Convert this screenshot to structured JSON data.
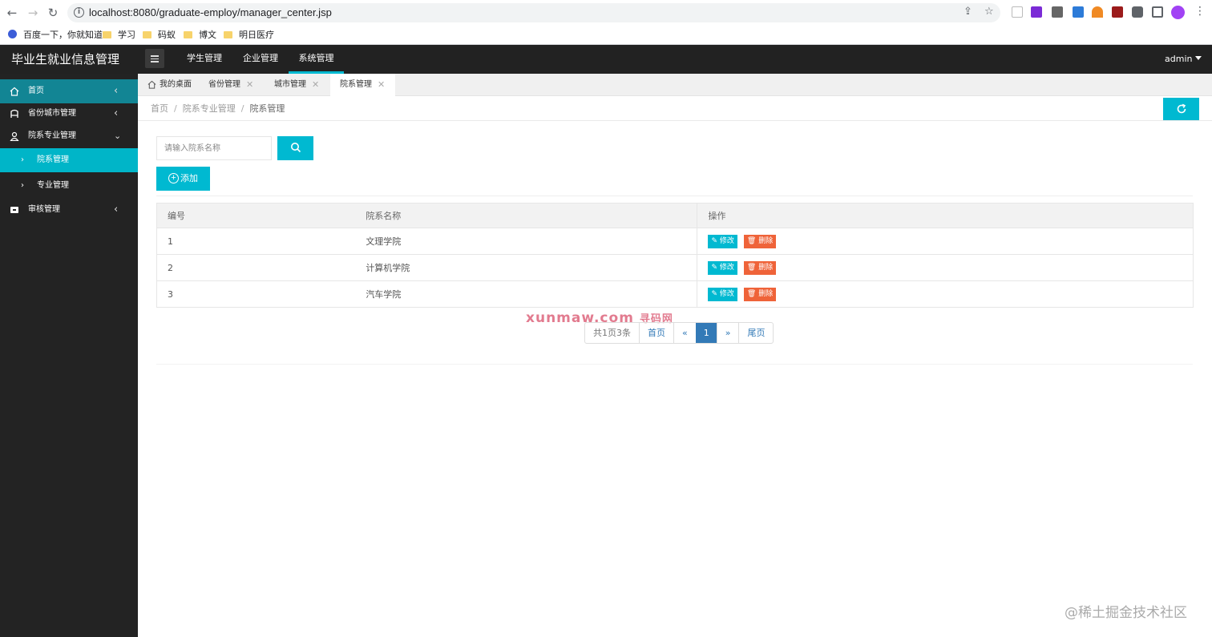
{
  "browser": {
    "url": "localhost:8080/graduate-employ/manager_center.jsp",
    "bookmarks": [
      "百度一下，你就知道",
      "学习",
      "码蚁",
      "博文",
      "明日医疗"
    ]
  },
  "app": {
    "title": "毕业生就业信息管理",
    "top_nav": [
      "学生管理",
      "企业管理",
      "系统管理"
    ],
    "user": "admin"
  },
  "sidebar": {
    "items": [
      {
        "label": "首页"
      },
      {
        "label": "省份城市管理"
      },
      {
        "label": "院系专业管理"
      },
      {
        "label": "院系管理"
      },
      {
        "label": "专业管理"
      },
      {
        "label": "审核管理"
      }
    ]
  },
  "tabs": [
    "我的桌面",
    "省份管理",
    "城市管理",
    "院系管理"
  ],
  "breadcrumb": [
    "首页",
    "院系专业管理",
    "院系管理"
  ],
  "search": {
    "placeholder": "请输入院系名称"
  },
  "add_button": "添加",
  "table": {
    "headers": [
      "编号",
      "院系名称",
      "操作"
    ],
    "rows": [
      {
        "id": "1",
        "name": "文理学院"
      },
      {
        "id": "2",
        "name": "计算机学院"
      },
      {
        "id": "3",
        "name": "汽车学院"
      }
    ],
    "edit_label": "修改",
    "delete_label": "删除"
  },
  "pagination": {
    "summary": "共1页3条",
    "first": "首页",
    "prev": "«",
    "current": "1",
    "next": "»",
    "last": "尾页"
  },
  "watermarks": {
    "center": "xunmaw.com",
    "center_cn": "寻码网",
    "corner": "@稀土掘金技术社区"
  },
  "colors": {
    "accent": "#00b9d1",
    "header_bg": "#222222",
    "sidebar_bg": "#232323",
    "danger": "#ef6339",
    "pager_active": "#337ab7"
  }
}
